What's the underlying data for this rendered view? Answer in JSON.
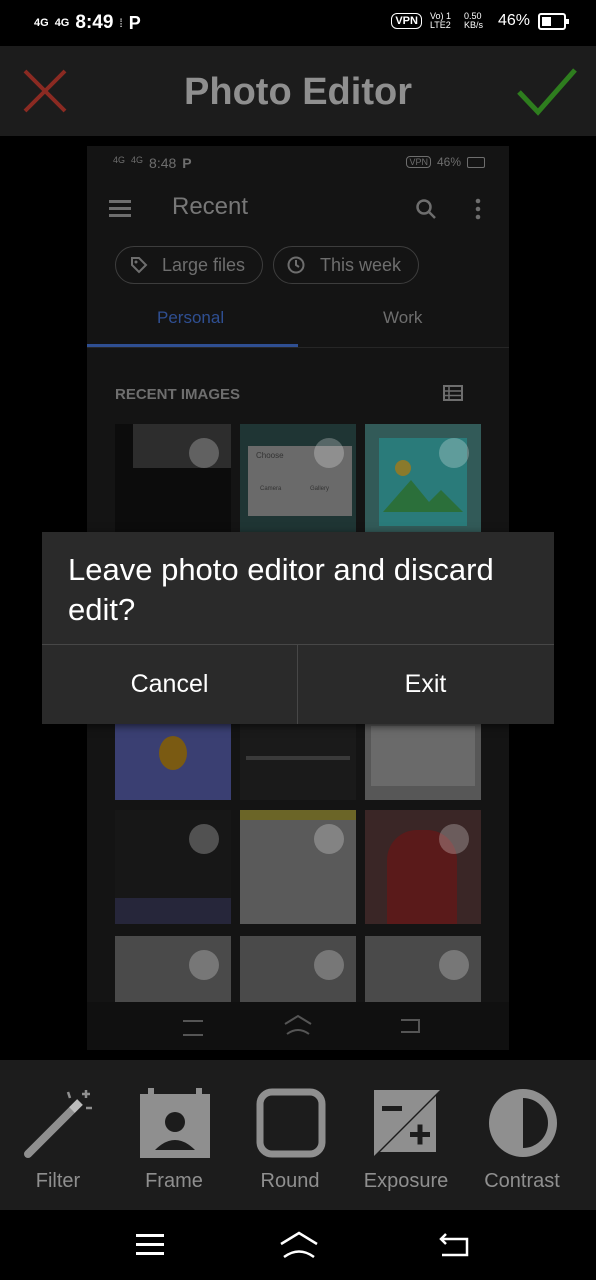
{
  "status": {
    "net1": "4G",
    "net2": "4G",
    "time": "8:49",
    "carrier_icon": "P",
    "vpn": "VPN",
    "volte": "Vo) 1 LTE2",
    "speed": "0.50 KB/s",
    "battery": "46%"
  },
  "header": {
    "title": "Photo Editor",
    "cancel_icon": "close-icon",
    "confirm_icon": "check-icon"
  },
  "preview": {
    "status_time": "8:48",
    "status_battery": "46%",
    "status_vpn": "VPN",
    "app_title": "Recent",
    "chips": [
      "Large files",
      "This week"
    ],
    "tabs": [
      "Personal",
      "Work"
    ],
    "section": "RECENT IMAGES",
    "dialog_thumb_choose": "Choose",
    "dialog_thumb_camera": "Camera",
    "dialog_thumb_gallery": "Gallery"
  },
  "dialog": {
    "message": "Leave photo editor and discard edit?",
    "cancel": "Cancel",
    "exit": "Exit"
  },
  "tools": [
    "Filter",
    "Frame",
    "Round",
    "Exposure",
    "Contrast"
  ],
  "colors": {
    "accent_red": "#8b2a22",
    "accent_green": "#2e7d1e",
    "toolbar_bg": "#1c1c1c",
    "dialog_bg": "#2a2a2a"
  }
}
